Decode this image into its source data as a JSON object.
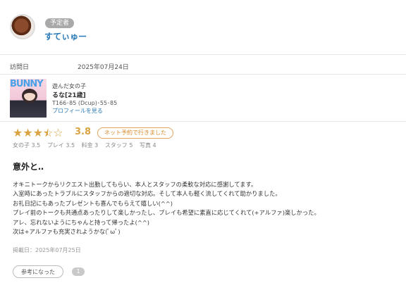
{
  "reviewer": {
    "badge": "予定者",
    "name": "すてぃゅー"
  },
  "visit": {
    "label": "訪問日",
    "date": "2025年07月24日"
  },
  "girl": {
    "photo_text": "BUNNY",
    "label": "遊んだ女の子",
    "name": "るな[21歳]",
    "stats": "T166･85 (Dcup)･55･85",
    "profile_link": "プロフィールを見る"
  },
  "rating": {
    "stars": 3.5,
    "score": "3.8",
    "net_badge": "ネット予約で行きました",
    "sub_scores": [
      "女の子 3.5",
      "プレイ 3.5",
      "料金 3",
      "スタッフ 5",
      "写真 4"
    ]
  },
  "review": {
    "title": "意外と‥",
    "lines": [
      "オキニトークからリクエスト出勤してもらい、本人とスタッフの柔軟な対応に感謝してます。",
      "入室時にあったトラブルにスタッフからの適切な対応。そして本人も軽く流してくれて助かりました。",
      "お礼日記にもあったプレゼントも喜んでもらえて嬉しい(^^)",
      "プレイ前のトークも共通点あったりして楽しかったし、プレイも希望に素直に応じてくれて(+アルファ)楽しかった。",
      "アレ、忘れないようにちゃんと持って帰ったよ(^^)",
      "次は+アルファも充実されようかな(ﾟωﾟ)"
    ],
    "posted": "掲載日：2025年07月25日"
  },
  "helpful": {
    "label": "参考になった",
    "count": "1"
  }
}
